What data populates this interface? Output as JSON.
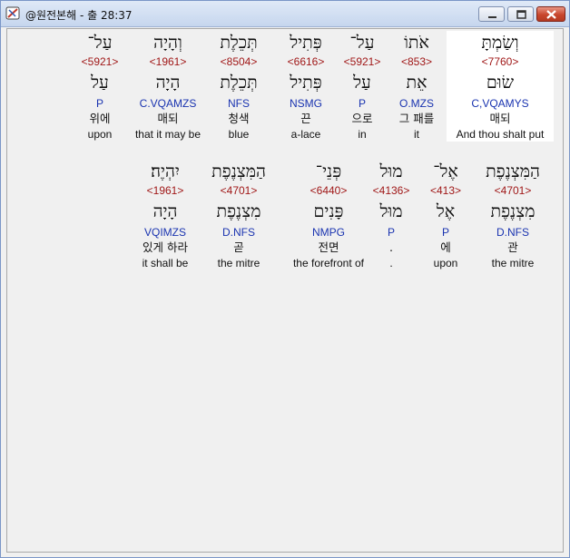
{
  "window": {
    "title": "@원전본해 - 출 28:37",
    "buttons": {
      "minimize": "minimize",
      "maximize": "maximize",
      "close": "close"
    }
  },
  "colors": {
    "strong": "#a01818",
    "parse": "#1a34b0"
  },
  "row1": [
    {
      "heb": "וְשַׂמְתָּ",
      "strong": "<7760>",
      "lemma": "שׂוּם",
      "parse": "C,VQAMYS",
      "kor": "매되",
      "eng": "And thou shalt put",
      "selected": true
    },
    {
      "heb": "אֹתוֹ",
      "strong": "<853>",
      "lemma": "אֵת",
      "parse": "O.MZS",
      "kor": "그 패를",
      "eng": "it"
    },
    {
      "heb": "עַל־",
      "strong": "<5921>",
      "lemma": "עַל",
      "parse": "P",
      "kor": "으로",
      "eng": "in"
    },
    {
      "heb": "פְּתִיל",
      "strong": "<6616>",
      "lemma": "פְּתִיל",
      "parse": "NSMG",
      "kor": "끈",
      "eng": "a-lace"
    },
    {
      "heb": "תְּכֵלֶת",
      "strong": "<8504>",
      "lemma": "תְּכֵלֶת",
      "parse": "NFS",
      "kor": "청색",
      "eng": "blue"
    },
    {
      "heb": "וְהָיָה",
      "strong": "<1961>",
      "lemma": "הָיָה",
      "parse": "C.VQAMZS",
      "kor": "매되",
      "eng": "that it may be"
    },
    {
      "heb": "עַל־",
      "strong": "<5921>",
      "lemma": "עַל",
      "parse": "P",
      "kor": "위에",
      "eng": "upon"
    }
  ],
  "row2": [
    {
      "heb": "הַמִּצְנֶפֶת",
      "strong": "<4701>",
      "lemma": "מִצְנֶפֶת",
      "parse": "D.NFS",
      "kor": "관",
      "eng": "the mitre"
    },
    {
      "heb": "אֶל־",
      "strong": "<413>",
      "lemma": "אֶל",
      "parse": "P",
      "kor": "에",
      "eng": "upon"
    },
    {
      "heb": "מוּל",
      "strong": "<4136>",
      "lemma": "מוּל",
      "parse": "P",
      "kor": ".",
      "eng": "."
    },
    {
      "heb": "פְּנֵי־",
      "strong": "<6440>",
      "lemma": "פָּנִים",
      "parse": "NMPG",
      "kor": "전면",
      "eng": "the forefront of"
    },
    {
      "heb": "הַמִּצְנֶפֶת",
      "strong": "<4701>",
      "lemma": "מִצְנֶפֶת",
      "parse": "D.NFS",
      "kor": "곧",
      "eng": "the mitre"
    },
    {
      "heb": "יִהְיֶה׃",
      "strong": "<1961>",
      "lemma": "הָיָה",
      "parse": "VQIMZS",
      "kor": "있게 하라",
      "eng": "it shall be"
    }
  ]
}
